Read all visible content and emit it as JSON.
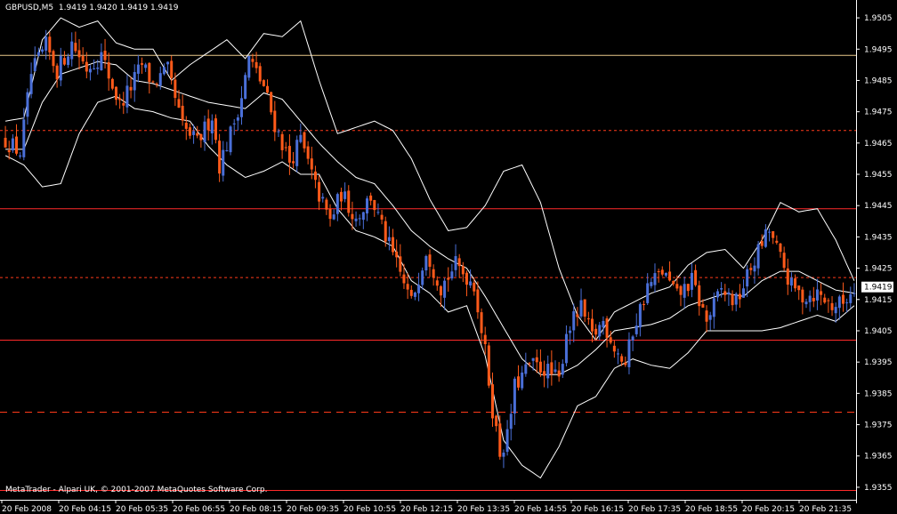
{
  "header": {
    "symbol": "GBPUSD,M5",
    "ohlc": "1.9419 1.9420 1.9419 1.9419"
  },
  "footer": {
    "copyright": "MetaTrader - Alpari UK, © 2001-2007 MetaQuotes Software Corp."
  },
  "colors": {
    "background": "#000000",
    "bull": "#4a6fd8",
    "bear": "#ff5a1a",
    "band": "#ffffff",
    "level_solid": "#ff2a2a",
    "level_dashed": "#ff3a1a",
    "top_line": "#e8c88a",
    "axis": "#ffffff"
  },
  "chart_data": {
    "type": "candlestick",
    "title": "GBPUSD,M5",
    "ylim": [
      1.9351,
      1.9509
    ],
    "y_ticks": [
      "1.9505",
      "1.9495",
      "1.9485",
      "1.9475",
      "1.9465",
      "1.9455",
      "1.9445",
      "1.9435",
      "1.9425",
      "1.9415",
      "1.9405",
      "1.9395",
      "1.9385",
      "1.9375",
      "1.9365",
      "1.9355"
    ],
    "x_ticks": [
      "20 Feb 2008",
      "20 Feb 04:15",
      "20 Feb 05:35",
      "20 Feb 06:55",
      "20 Feb 08:15",
      "20 Feb 09:35",
      "20 Feb 10:55",
      "20 Feb 12:15",
      "20 Feb 13:35",
      "20 Feb 14:55",
      "20 Feb 16:15",
      "20 Feb 17:35",
      "20 Feb 18:55",
      "20 Feb 20:15",
      "20 Feb 21:35"
    ],
    "last_price": "1.9419",
    "close_path": [
      [
        0,
        1.9466
      ],
      [
        4,
        1.9462
      ],
      [
        7,
        1.9487
      ],
      [
        11,
        1.9496
      ],
      [
        14,
        1.9488
      ],
      [
        18,
        1.9497
      ],
      [
        22,
        1.9489
      ],
      [
        26,
        1.9493
      ],
      [
        31,
        1.9477
      ],
      [
        34,
        1.9483
      ],
      [
        37,
        1.949
      ],
      [
        40,
        1.9484
      ],
      [
        44,
        1.9488
      ],
      [
        48,
        1.947
      ],
      [
        52,
        1.9465
      ],
      [
        56,
        1.9474
      ],
      [
        58,
        1.9458
      ],
      [
        61,
        1.9468
      ],
      [
        64,
        1.948
      ],
      [
        66,
        1.9492
      ],
      [
        70,
        1.9483
      ],
      [
        73,
        1.9471
      ],
      [
        77,
        1.9459
      ],
      [
        80,
        1.9466
      ],
      [
        84,
        1.9451
      ],
      [
        88,
        1.944
      ],
      [
        91,
        1.9449
      ],
      [
        95,
        1.9441
      ],
      [
        99,
        1.9448
      ],
      [
        102,
        1.9438
      ],
      [
        106,
        1.9426
      ],
      [
        110,
        1.9414
      ],
      [
        114,
        1.9431
      ],
      [
        118,
        1.9419
      ],
      [
        122,
        1.9426
      ],
      [
        127,
        1.942
      ],
      [
        130,
        1.9398
      ],
      [
        132,
        1.938
      ],
      [
        134,
        1.9366
      ],
      [
        136,
        1.9371
      ],
      [
        138,
        1.9387
      ],
      [
        142,
        1.9394
      ],
      [
        146,
        1.9393
      ],
      [
        150,
        1.9389
      ],
      [
        152,
        1.9405
      ],
      [
        156,
        1.9412
      ],
      [
        159,
        1.9403
      ],
      [
        162,
        1.9408
      ],
      [
        165,
        1.94
      ],
      [
        168,
        1.9394
      ],
      [
        170,
        1.9405
      ],
      [
        174,
        1.9419
      ],
      [
        178,
        1.9424
      ],
      [
        182,
        1.9416
      ],
      [
        186,
        1.9421
      ],
      [
        190,
        1.9408
      ],
      [
        194,
        1.9418
      ],
      [
        198,
        1.9414
      ],
      [
        202,
        1.9425
      ],
      [
        205,
        1.9433
      ],
      [
        207,
        1.9437
      ],
      [
        210,
        1.9428
      ],
      [
        213,
        1.9419
      ],
      [
        216,
        1.9416
      ],
      [
        220,
        1.9417
      ],
      [
        224,
        1.9413
      ],
      [
        227,
        1.9414
      ],
      [
        230,
        1.9419
      ]
    ],
    "bollinger": {
      "upper": [
        [
          0,
          1.9472
        ],
        [
          5,
          1.9473
        ],
        [
          10,
          1.9498
        ],
        [
          15,
          1.9505
        ],
        [
          20,
          1.9502
        ],
        [
          25,
          1.9504
        ],
        [
          30,
          1.9497
        ],
        [
          35,
          1.9495
        ],
        [
          40,
          1.9495
        ],
        [
          45,
          1.9485
        ],
        [
          50,
          1.949
        ],
        [
          55,
          1.9494
        ],
        [
          60,
          1.9498
        ],
        [
          65,
          1.9492
        ],
        [
          70,
          1.95
        ],
        [
          75,
          1.9499
        ],
        [
          80,
          1.9504
        ],
        [
          85,
          1.9485
        ],
        [
          90,
          1.9468
        ],
        [
          95,
          1.947
        ],
        [
          100,
          1.9472
        ],
        [
          105,
          1.9469
        ],
        [
          110,
          1.946
        ],
        [
          115,
          1.9447
        ],
        [
          120,
          1.9437
        ],
        [
          125,
          1.9438
        ],
        [
          130,
          1.9445
        ],
        [
          135,
          1.9456
        ],
        [
          140,
          1.9458
        ],
        [
          145,
          1.9446
        ],
        [
          150,
          1.9425
        ],
        [
          155,
          1.941
        ],
        [
          160,
          1.9402
        ],
        [
          165,
          1.9411
        ],
        [
          170,
          1.9414
        ],
        [
          175,
          1.9417
        ],
        [
          180,
          1.9419
        ],
        [
          185,
          1.9426
        ],
        [
          190,
          1.943
        ],
        [
          195,
          1.9431
        ],
        [
          200,
          1.9425
        ],
        [
          205,
          1.9434
        ],
        [
          210,
          1.9446
        ],
        [
          215,
          1.9443
        ],
        [
          220,
          1.9444
        ],
        [
          225,
          1.9434
        ],
        [
          230,
          1.9421
        ]
      ],
      "middle": [
        [
          0,
          1.9463
        ],
        [
          5,
          1.9463
        ],
        [
          10,
          1.9478
        ],
        [
          15,
          1.9487
        ],
        [
          20,
          1.9489
        ],
        [
          25,
          1.9491
        ],
        [
          30,
          1.949
        ],
        [
          35,
          1.9485
        ],
        [
          40,
          1.9484
        ],
        [
          45,
          1.9482
        ],
        [
          50,
          1.948
        ],
        [
          55,
          1.9478
        ],
        [
          60,
          1.9477
        ],
        [
          65,
          1.9476
        ],
        [
          70,
          1.9481
        ],
        [
          75,
          1.9479
        ],
        [
          80,
          1.9472
        ],
        [
          85,
          1.9465
        ],
        [
          90,
          1.9459
        ],
        [
          95,
          1.9454
        ],
        [
          100,
          1.9452
        ],
        [
          105,
          1.9445
        ],
        [
          110,
          1.9437
        ],
        [
          115,
          1.9432
        ],
        [
          120,
          1.9428
        ],
        [
          125,
          1.9425
        ],
        [
          130,
          1.9416
        ],
        [
          135,
          1.9406
        ],
        [
          140,
          1.9396
        ],
        [
          145,
          1.9391
        ],
        [
          150,
          1.9391
        ],
        [
          155,
          1.9394
        ],
        [
          160,
          1.9399
        ],
        [
          165,
          1.9405
        ],
        [
          170,
          1.9406
        ],
        [
          175,
          1.9407
        ],
        [
          180,
          1.9409
        ],
        [
          185,
          1.9413
        ],
        [
          190,
          1.9415
        ],
        [
          195,
          1.9417
        ],
        [
          200,
          1.9416
        ],
        [
          205,
          1.9421
        ],
        [
          210,
          1.9424
        ],
        [
          215,
          1.9424
        ],
        [
          220,
          1.9421
        ],
        [
          225,
          1.9418
        ],
        [
          230,
          1.9417
        ]
      ],
      "lower": [
        [
          0,
          1.9461
        ],
        [
          5,
          1.9458
        ],
        [
          10,
          1.9451
        ],
        [
          15,
          1.9452
        ],
        [
          20,
          1.9468
        ],
        [
          25,
          1.9478
        ],
        [
          30,
          1.948
        ],
        [
          35,
          1.9476
        ],
        [
          40,
          1.9475
        ],
        [
          45,
          1.9473
        ],
        [
          50,
          1.9472
        ],
        [
          55,
          1.9464
        ],
        [
          60,
          1.9458
        ],
        [
          65,
          1.9454
        ],
        [
          70,
          1.9456
        ],
        [
          75,
          1.9459
        ],
        [
          80,
          1.9455
        ],
        [
          85,
          1.9455
        ],
        [
          90,
          1.9444
        ],
        [
          95,
          1.9437
        ],
        [
          100,
          1.9435
        ],
        [
          105,
          1.9432
        ],
        [
          110,
          1.9421
        ],
        [
          115,
          1.9417
        ],
        [
          120,
          1.9411
        ],
        [
          125,
          1.9413
        ],
        [
          130,
          1.9397
        ],
        [
          135,
          1.937
        ],
        [
          140,
          1.9362
        ],
        [
          145,
          1.9358
        ],
        [
          150,
          1.9368
        ],
        [
          155,
          1.9381
        ],
        [
          160,
          1.9384
        ],
        [
          165,
          1.9393
        ],
        [
          170,
          1.9396
        ],
        [
          175,
          1.9394
        ],
        [
          180,
          1.9393
        ],
        [
          185,
          1.9398
        ],
        [
          190,
          1.9405
        ],
        [
          195,
          1.9405
        ],
        [
          200,
          1.9405
        ],
        [
          205,
          1.9405
        ],
        [
          210,
          1.9406
        ],
        [
          215,
          1.9408
        ],
        [
          220,
          1.941
        ],
        [
          225,
          1.9408
        ],
        [
          230,
          1.9413
        ]
      ]
    },
    "levels": [
      {
        "price": 1.9493,
        "style": "solid",
        "color": "#e8c88a"
      },
      {
        "price": 1.9469,
        "style": "dotted",
        "color": "#ff3a1a"
      },
      {
        "price": 1.9444,
        "style": "solid",
        "color": "#ff2a2a"
      },
      {
        "price": 1.9422,
        "style": "dotted",
        "color": "#ff3a1a"
      },
      {
        "price": 1.9402,
        "style": "solid",
        "color": "#ff2a2a"
      },
      {
        "price": 1.9379,
        "style": "dashed",
        "color": "#ff3a1a"
      },
      {
        "price": 1.9354,
        "style": "solid",
        "color": "#ff2a2a"
      }
    ],
    "grid": false,
    "legend": "none"
  }
}
